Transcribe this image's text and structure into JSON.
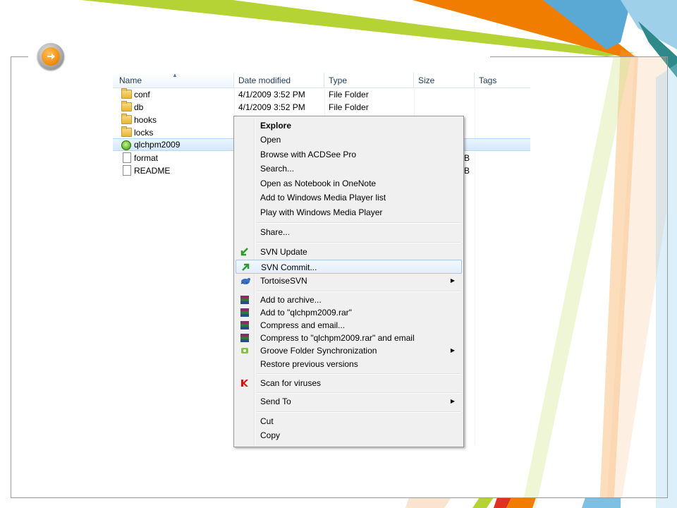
{
  "explorer": {
    "columns": [
      "Name",
      "Date modified",
      "Type",
      "Size",
      "Tags"
    ],
    "files": [
      {
        "name": "conf",
        "date": "4/1/2009 3:52 PM",
        "type": "File Folder",
        "size": "",
        "icon": "folder-icon"
      },
      {
        "name": "db",
        "date": "4/1/2009 3:52 PM",
        "type": "File Folder",
        "size": "",
        "icon": "folder-icon"
      },
      {
        "name": "hooks",
        "date": "",
        "type": "",
        "size": "",
        "icon": "folder-icon"
      },
      {
        "name": "locks",
        "date": "",
        "type": "",
        "size": "",
        "icon": "folder-icon"
      },
      {
        "name": "qlchpm2009",
        "date": "",
        "type": "",
        "size": "",
        "icon": "svn-folder-icon"
      },
      {
        "name": "format",
        "date": "",
        "type": "",
        "size": "B",
        "icon": "document-icon"
      },
      {
        "name": "README",
        "date": "",
        "type": "",
        "size": "B",
        "icon": "document-icon"
      }
    ]
  },
  "context_menu": {
    "groups": [
      [
        {
          "label": "Explore",
          "bold": true
        },
        {
          "label": "Open"
        },
        {
          "label": "Browse with ACDSee Pro"
        },
        {
          "label": "Search..."
        },
        {
          "label": "Open as Notebook in OneNote"
        },
        {
          "label": "Add to Windows Media Player list"
        },
        {
          "label": "Play with Windows Media Player"
        }
      ],
      [
        {
          "label": "Share..."
        }
      ],
      [
        {
          "label": "SVN Update",
          "icon": "svn-update-icon"
        },
        {
          "label": "SVN Commit...",
          "icon": "svn-commit-icon",
          "highlighted": true
        },
        {
          "label": "TortoiseSVN",
          "icon": "tortoisesvn-icon",
          "submenu": true
        }
      ],
      [
        {
          "label": "Add to archive...",
          "icon": "winrar-icon"
        },
        {
          "label": "Add to \"qlchpm2009.rar\"",
          "icon": "winrar-icon"
        },
        {
          "label": "Compress and email...",
          "icon": "winrar-icon"
        },
        {
          "label": "Compress to \"qlchpm2009.rar\" and email",
          "icon": "winrar-icon"
        },
        {
          "label": "Groove Folder Synchronization",
          "icon": "groove-icon",
          "submenu": true
        },
        {
          "label": "Restore previous versions"
        }
      ],
      [
        {
          "label": "Scan for viruses",
          "icon": "kaspersky-icon"
        }
      ],
      [
        {
          "label": "Send To",
          "submenu": true
        }
      ],
      [
        {
          "label": "Cut"
        },
        {
          "label": "Copy"
        }
      ]
    ]
  },
  "colors": {
    "accent_orange": "#f07c00",
    "accent_lime": "#b5d334",
    "accent_blue": "#6ab0d8",
    "selection": "#d5e9fb"
  }
}
